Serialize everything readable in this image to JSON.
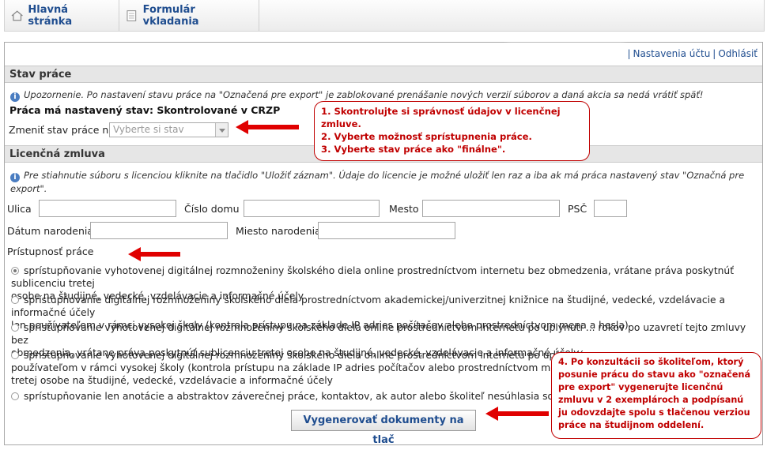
{
  "nav": {
    "home_label": "Hlavná stránka",
    "form_label": "Formulár vkladania"
  },
  "account": {
    "settings_label": "Nastavenia účtu",
    "logout_label": "Odhlásiť"
  },
  "status_section": {
    "title": "Stav práce",
    "warning": "Upozornenie. Po nastavení stavu práce na \"Označená pre export\" je zablokované prenášanie nových verzií súborov a daná akcia sa nedá vrátiť späť!",
    "current_status": "Práca má nastavený stav: Skontrolované v CRZP",
    "change_label": "Zmeniť stav práce na",
    "select_placeholder": "Vyberte si stav"
  },
  "license_section": {
    "title": "Licenčná zmluva",
    "info_line1": "Pre stiahnutie súboru s licenciou kliknite na tlačidlo \"Uložiť záznam\". Údaje do licencie je možné uložiť len raz a iba ak má práca nastavený stav \"Označná pre",
    "info_line2": "export\".",
    "street_label": "Ulica",
    "house_no_label": "Číslo domu",
    "city_label": "Mesto",
    "zip_label": "PSČ",
    "birthdate_label": "Dátum narodenia",
    "birthplace_label": "Miesto narodenia",
    "access_label": "Prístupnosť práce"
  },
  "access_options": [
    {
      "line1": "sprístupňovanie vyhotovenej digitálnej rozmnoženiny školského diela online prostredníctvom internetu bez obmedzenia, vrátane práva poskytnúť sublicenciu tretej",
      "line2": "osobe na študijné, vedecké, vzdelávacie a informačné účely",
      "selected": true
    },
    {
      "line1": "sprístupňovanie digitálnej rozmnoženiny školského diela prostredníctvom akademickej/univerzitnej knižnice na študijné, vedecké, vzdelávacie a informačné účely",
      "line2": "len používateľom v rámci vysokej školy (kontrola prístupu na základe IP adries počítačov alebo prostredníctvom mena a hesla)",
      "selected": false
    },
    {
      "line1": "sprístupňovanie vyhotovenej digitálnej rozmnoženiny školského diela online prostredníctvom internetu po uplynutí ... rokov po uzavretí tejto zmluvy bez",
      "line2": "obmedzenia, vrátane práva poskytnúť sublicenciu tretej osobe na študijné, vedecké, vzdelávacie a informačné účely",
      "selected": false
    },
    {
      "line1": "sprístupňovanie vyhotovenej digitálnej rozmnoženiny školského diela online prostredníctvom internetu po uplynutí ...",
      "line2": "používateľom v rámci vysokej školy (kontrola prístupu na základe IP adries počítačov alebo prostredníctvom mena a hes",
      "line3": "tretej osobe na študijné, vedecké, vzdelávacie a informačné účely",
      "selected": false
    },
    {
      "line1": "sprístupňovanie len anotácie a abstraktov záverečnej práce, kontaktov, ak autor alebo školiteľ nesúhlasia so zverejn",
      "selected": false
    }
  ],
  "generate_button": "Vygenerovať dokumenty na tlač",
  "callout_top": {
    "l1": "1. Skontrolujte si správnosť údajov v licenčnej",
    "l2": "zmluve.",
    "l3": "2. Vyberte možnosť sprístupnenia práce.",
    "l4": "3. Vyberte stav práce ako \"finálne\"."
  },
  "callout_bottom": {
    "l1": "4. Po konzultácii so školiteľom, ktorý",
    "l2": "posunie prácu do stavu ako \"označená",
    "l3": "pre export\" vygenerujte licenčnú",
    "l4": "zmluvu v 2 exemplároch a podpísanú",
    "l5": "ju odovzdajte spolu s tlačenou verziou",
    "l6": "práce na študijnom oddelení."
  },
  "colors": {
    "link": "#1f4d8f",
    "annotation": "#c00000",
    "section_bg": "#e6e6e6"
  }
}
